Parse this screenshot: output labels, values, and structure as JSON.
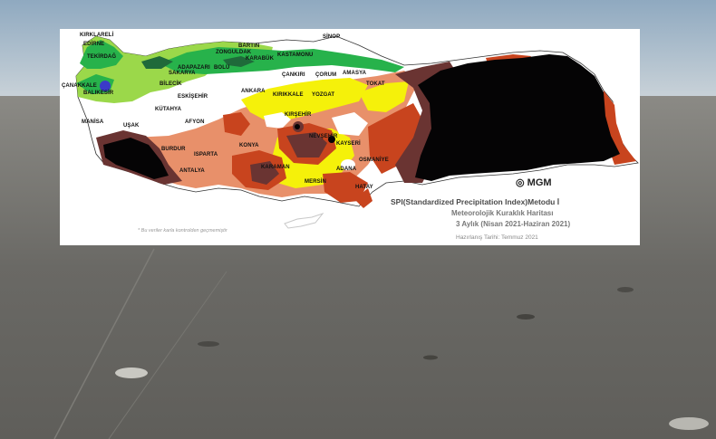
{
  "map": {
    "cities": [
      {
        "label": "KIRKLARELİ"
      },
      {
        "label": "EDİRNE"
      },
      {
        "label": "TEKİRDAĞ"
      },
      {
        "label": "ÇANAKKALE"
      },
      {
        "label": "BALIKESİR"
      },
      {
        "label": "BİLECİK"
      },
      {
        "label": "SAKARYA"
      },
      {
        "label": "ADAPAZARI"
      },
      {
        "label": "BOLU"
      },
      {
        "label": "ZONGULDAK"
      },
      {
        "label": "BARTIN"
      },
      {
        "label": "KARABÜK"
      },
      {
        "label": "KASTAMONU"
      },
      {
        "label": "SİNOP"
      },
      {
        "label": "ÇANKIRI"
      },
      {
        "label": "ÇORUM"
      },
      {
        "label": "AMASYA"
      },
      {
        "label": "TOKAT"
      },
      {
        "label": "ANKARA"
      },
      {
        "label": "KIRIKKALE"
      },
      {
        "label": "YOZGAT"
      },
      {
        "label": "ESKİŞEHİR"
      },
      {
        "label": "KÜTAHYA"
      },
      {
        "label": "AFYON"
      },
      {
        "label": "KIRŞEHİR"
      },
      {
        "label": "NEVŞEHİR"
      },
      {
        "label": "KAYSERİ"
      },
      {
        "label": "MANİSA"
      },
      {
        "label": "UŞAK"
      },
      {
        "label": "ISPARTA"
      },
      {
        "label": "BURDUR"
      },
      {
        "label": "KONYA"
      },
      {
        "label": "KARAMAN"
      },
      {
        "label": "ANTALYA"
      },
      {
        "label": "MERSİN"
      },
      {
        "label": "ADANA"
      },
      {
        "label": "OSMANİYE"
      },
      {
        "label": "HATAY"
      }
    ],
    "logo": "MGM",
    "legend": {
      "line1": "SPI(Standardized Precipitation Index)Metodu İ",
      "line2": "Meteorolojik Kuraklık Haritası",
      "line3": "3 Aylık (Nisan 2021-Haziran 2021)",
      "line4": "Hazırlanış Tarihi: Temmuz 2021"
    },
    "footnote": "* Bu veriler karla kontrolden geçmemiştir"
  },
  "colors": {
    "extreme_drought": "#050405",
    "severe_drought": "#6a3432",
    "moderate_drought": "#c8441e",
    "mild_drought": "#e8906a",
    "near_normal_dry": "#f5f10a",
    "normal": "#ffffff",
    "mild_wet": "#9bd84a",
    "moderate_wet": "#27b24b",
    "severe_wet": "#1f6a3a"
  }
}
